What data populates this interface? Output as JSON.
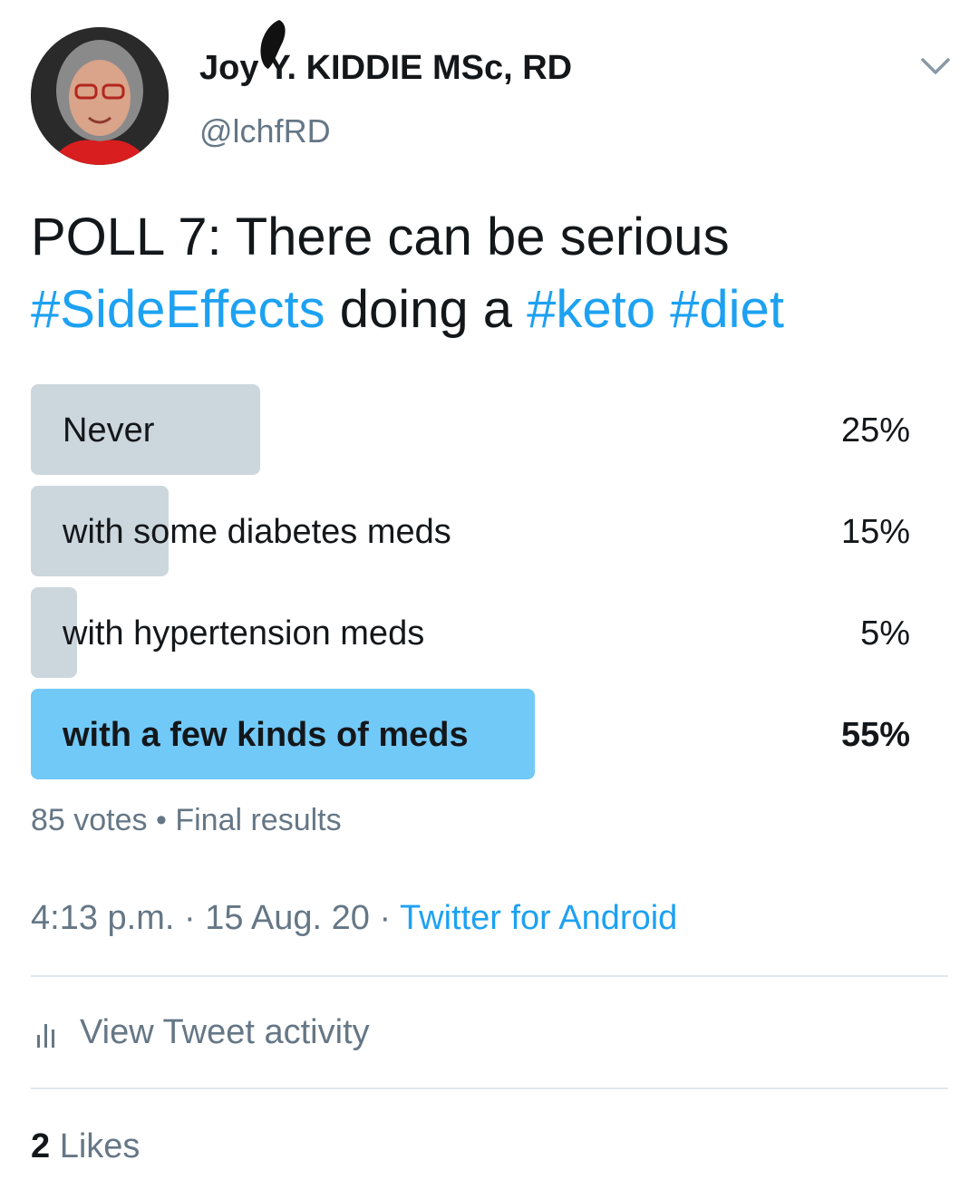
{
  "author": {
    "display_name": "Joy Y. KIDDIE MSc, RD",
    "handle": "@lchfRD"
  },
  "tweet": {
    "text_part1": "POLL 7: There can be serious",
    "hashtag1": "#SideEffects",
    "text_part2": "doing a",
    "hashtag2": "#keto",
    "hashtag3": "#diet"
  },
  "poll": {
    "options": [
      {
        "label": "Never",
        "percent_label": "25%",
        "percent": 25,
        "winner": false
      },
      {
        "label": "with some diabetes meds",
        "percent_label": "15%",
        "percent": 15,
        "winner": false
      },
      {
        "label": "with hypertension meds",
        "percent_label": "5%",
        "percent": 5,
        "winner": false
      },
      {
        "label": "with a few kinds of meds",
        "percent_label": "55%",
        "percent": 55,
        "winner": true
      }
    ],
    "votes": "85 votes",
    "separator": "•",
    "status": "Final results"
  },
  "meta": {
    "time": "4:13 p.m.",
    "date": "15 Aug. 20",
    "dot": "·",
    "source": "Twitter for Android"
  },
  "actions": {
    "activity_label": "View Tweet activity"
  },
  "stats": {
    "likes_count": "2",
    "likes_label": "Likes"
  },
  "colors": {
    "link": "#1da1f2",
    "poll_bar": "#ccd6dd",
    "poll_winner": "#71c9f8",
    "secondary_text": "#657786"
  },
  "icons": {
    "caret": "chevron-down-icon",
    "activity": "bar-chart-icon"
  }
}
